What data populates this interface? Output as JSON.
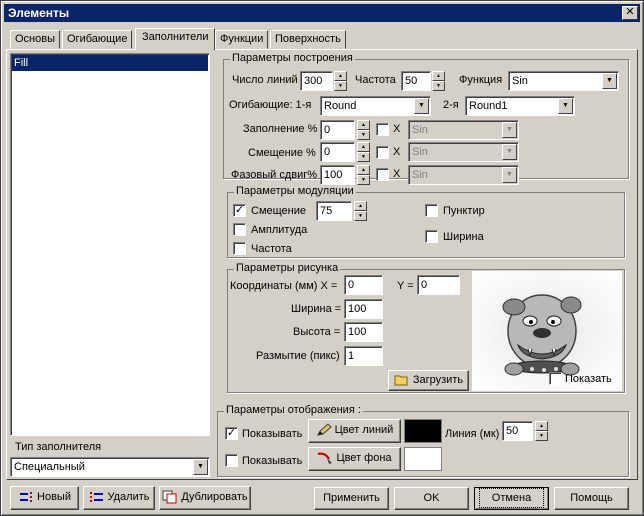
{
  "window": {
    "title": "Элементы",
    "close_glyph": "✕"
  },
  "tabs": [
    {
      "label": "Основы"
    },
    {
      "label": "Огибающие"
    },
    {
      "label": "Заполнители"
    },
    {
      "label": "Функции"
    },
    {
      "label": "Поверхность"
    }
  ],
  "fill_list": {
    "items": [
      "Fill"
    ]
  },
  "fill_type": {
    "label": "Тип заполнителя",
    "value": "Специальный"
  },
  "build": {
    "title": "Параметры построения",
    "lines_label": "Число линий",
    "lines_value": "300",
    "freq_label": "Частота",
    "freq_value": "50",
    "func_label": "Функция",
    "func_value": "Sin",
    "env1_label": "Огибающие: 1-я",
    "env1_value": "Round",
    "env2_label": "2-я",
    "env2_value": "Round1",
    "fill_label": "Заполнение %",
    "fill_value": "0",
    "offset_label": "Смещение %",
    "offset_value": "0",
    "phase_label": "Фазовый сдвиг%",
    "phase_value": "100",
    "x_label": "X",
    "disabled_func": "Sin"
  },
  "modulation": {
    "title": "Параметры модуляции",
    "offset_label": "Смещение",
    "offset_value": "75",
    "amp_label": "Амплитуда",
    "freq_label": "Частота",
    "dotted_label": "Пунктир",
    "width_label": "Ширина"
  },
  "picture": {
    "title": "Параметры рисунка",
    "coords_label": "Координаты (мм)  X =",
    "x_value": "0",
    "y_label": "Y =",
    "y_value": "0",
    "width_label": "Ширина =",
    "width_value": "100",
    "height_label": "Высота =",
    "height_value": "100",
    "blur_label": "Размытие (пикс)",
    "blur_value": "1",
    "load_label": "Загрузить",
    "show_label": "Показать"
  },
  "display": {
    "title": "Параметры отображения :",
    "show1_label": "Показывать",
    "show2_label": "Показывать",
    "line_color_label": "Цвет линий",
    "bg_color_label": "Цвет фона",
    "line_width_label": "Линия (мк)",
    "line_width_value": "50",
    "line_color": "#000000",
    "bg_color": "#ffffff"
  },
  "footer": {
    "new_label": "Новый",
    "delete_label": "Удалить",
    "dup_label": "Дублировать",
    "apply_label": "Применить",
    "ok_label": "OK",
    "cancel_label": "Отмена",
    "help_label": "Помощь"
  }
}
